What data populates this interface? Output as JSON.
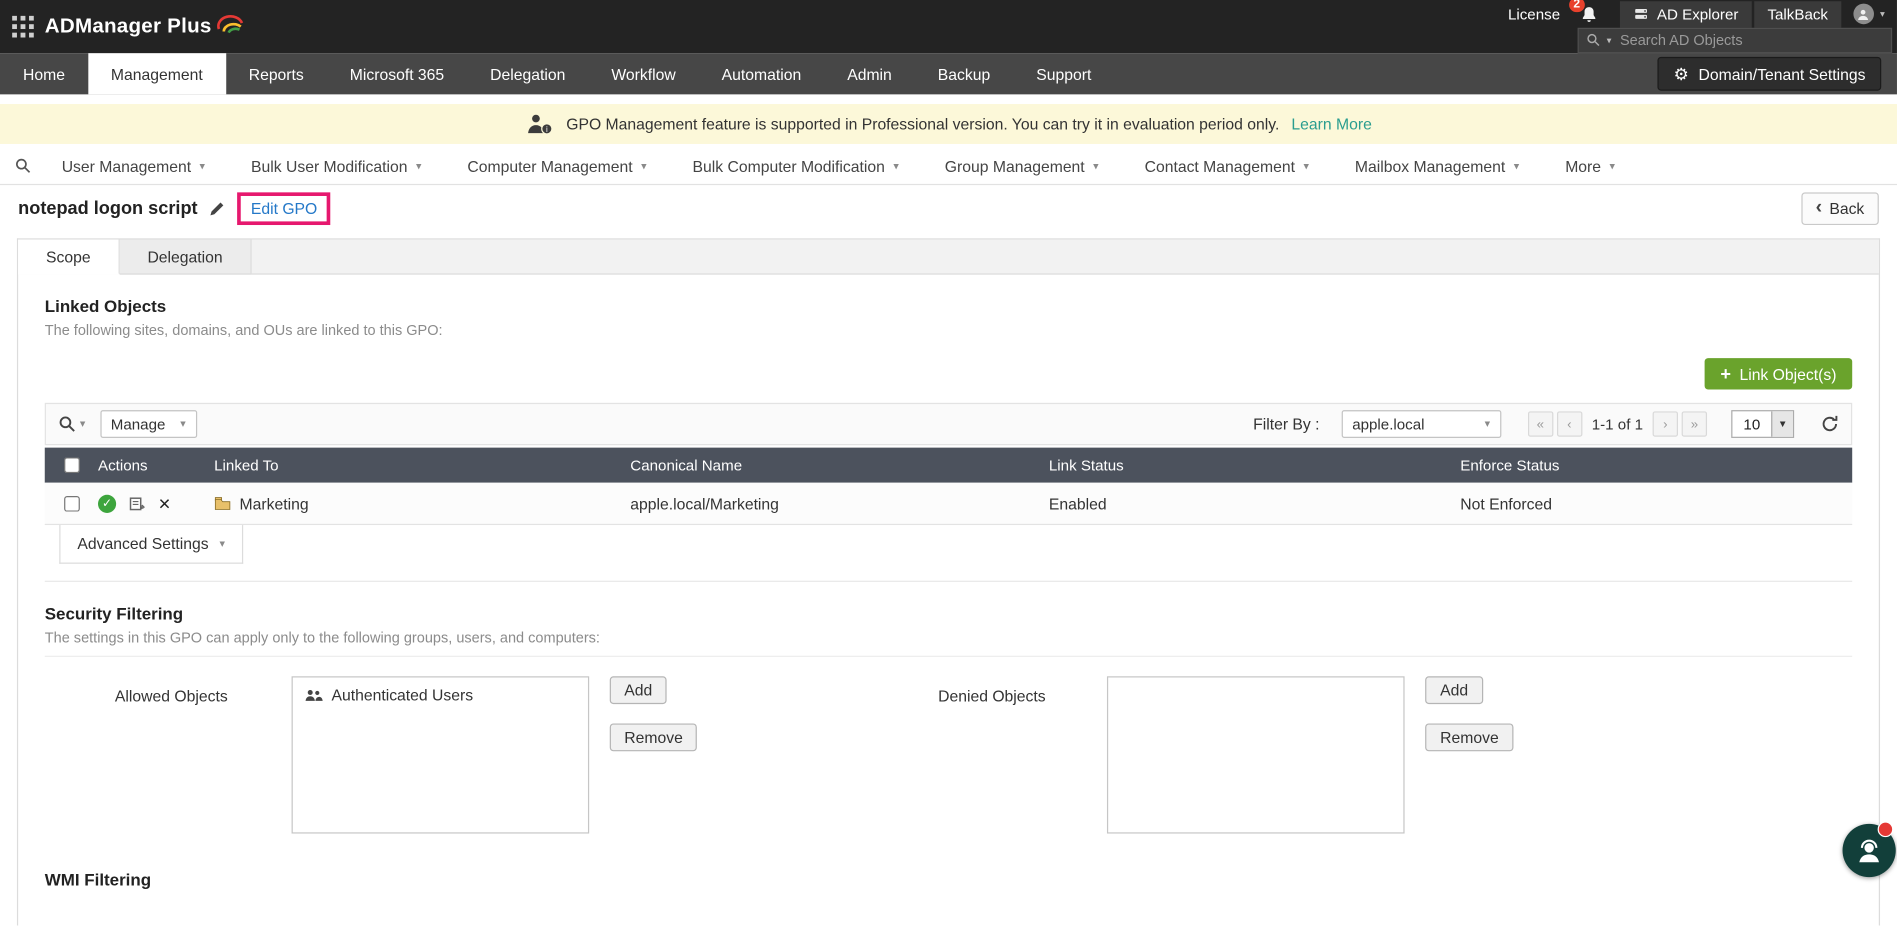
{
  "topbar": {
    "app_name": "ADManager Plus",
    "license_label": "License",
    "notification_count": "2",
    "ad_explorer_label": "AD Explorer",
    "talkback_label": "TalkBack",
    "search_placeholder": "Search AD Objects"
  },
  "nav": {
    "tabs": [
      "Home",
      "Management",
      "Reports",
      "Microsoft 365",
      "Delegation",
      "Workflow",
      "Automation",
      "Admin",
      "Backup",
      "Support"
    ],
    "active_tab": "Management",
    "domain_settings_label": "Domain/Tenant Settings"
  },
  "banner": {
    "message": "GPO Management feature is supported in Professional version. You can try it in evaluation period only.",
    "link_label": "Learn More"
  },
  "menubar": {
    "items": [
      "User Management",
      "Bulk User Modification",
      "Computer Management",
      "Bulk Computer Modification",
      "Group Management",
      "Contact Management",
      "Mailbox Management",
      "More"
    ]
  },
  "page_header": {
    "title": "notepad logon script",
    "edit_gpo_label": "Edit GPO",
    "back_label": "Back"
  },
  "tabs": {
    "scope": "Scope",
    "delegation": "Delegation"
  },
  "linked_objects": {
    "heading": "Linked Objects",
    "description": "The following sites, domains, and OUs are linked to this GPO:",
    "link_button_label": "Link Object(s)",
    "toolbar": {
      "manage_label": "Manage",
      "filter_label": "Filter By :",
      "filter_value": "apple.local",
      "page_range": "1-1 of 1",
      "page_size": "10"
    },
    "table": {
      "columns": [
        "Actions",
        "Linked To",
        "Canonical Name",
        "Link Status",
        "Enforce Status"
      ],
      "rows": [
        {
          "linked_to": "Marketing",
          "canonical_name": "apple.local/Marketing",
          "link_status": "Enabled",
          "enforce_status": "Not Enforced"
        }
      ]
    },
    "advanced_settings_label": "Advanced Settings"
  },
  "security_filtering": {
    "heading": "Security Filtering",
    "description": "The settings in this GPO can apply only to the following groups, users, and computers:",
    "allowed_label": "Allowed Objects",
    "allowed_items": [
      "Authenticated Users"
    ],
    "denied_label": "Denied Objects",
    "add_label": "Add",
    "remove_label": "Remove"
  },
  "wmi_filtering": {
    "heading": "WMI Filtering"
  },
  "colors": {
    "accent_green": "#6aa32c",
    "link_blue": "#2478c8",
    "annotation_highlight": "#e6186e",
    "table_header": "#4c525d",
    "banner_bg": "#fcf8d9",
    "learn_more_link": "#2a9d8f"
  }
}
